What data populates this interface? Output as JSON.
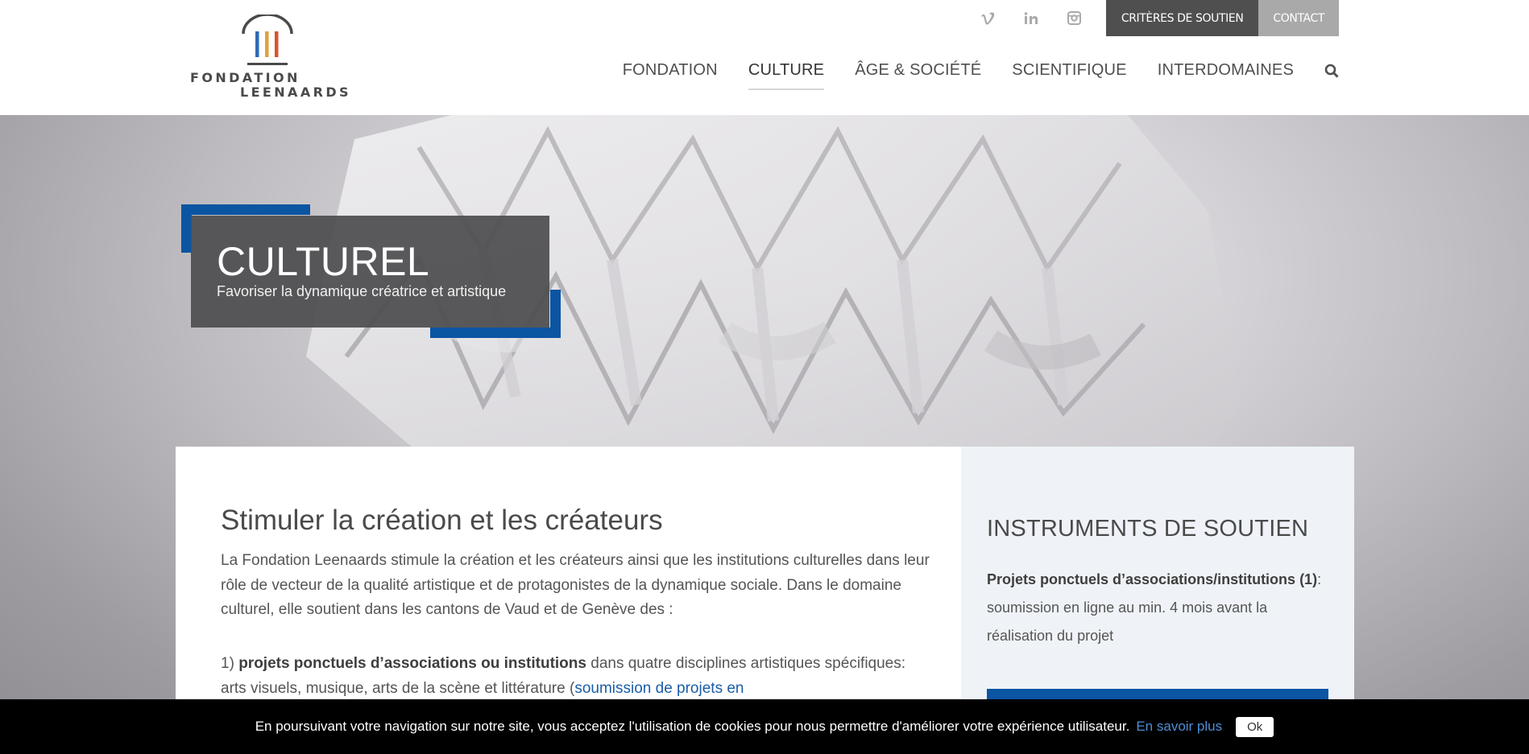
{
  "brand": {
    "line1": "FONDATION",
    "line2": "LEENAARDS",
    "stripe_colors": [
      "#2e6ab3",
      "#e0a23a",
      "#d9542c"
    ]
  },
  "social": [
    {
      "name": "vimeo-icon",
      "glyph": "v"
    },
    {
      "name": "linkedin-icon",
      "glyph": "in"
    },
    {
      "name": "instagram-icon",
      "glyph": "instagram"
    }
  ],
  "topbar": {
    "criteres": "CRITÈRES DE SOUTIEN",
    "contact": "CONTACT"
  },
  "nav": {
    "items": [
      {
        "label": "FONDATION"
      },
      {
        "label": "CULTURE"
      },
      {
        "label": "ÂGE & SOCIÉTÉ"
      },
      {
        "label": "SCIENTIFIQUE"
      },
      {
        "label": "INTERDOMAINES"
      }
    ],
    "active": "CULTURE",
    "search_icon": "search-icon"
  },
  "hero": {
    "title": "CULTUREL",
    "subtitle": "Favoriser la dynamique créatrice et artistique",
    "accent_color": "#0b55a2"
  },
  "main": {
    "heading": "Stimuler la création et les créateurs",
    "intro": "La Fondation Leenaards stimule la création et les créateurs ainsi que les institutions culturelles dans leur rôle de vecteur de la qualité artistique et de protagonistes de la dynamique sociale. Dans le domaine culturel, elle soutient dans les cantons de Vaud et de Genève des :",
    "item1_prefix": "1) ",
    "item1_bold": "projets ponctuels d’associations ou institutions",
    "item1_text": " dans quatre disciplines artistiques spécifiques: arts visuels, musique, arts de la scène et littérature (",
    "item1_link": "soumission de projets en"
  },
  "sidebar": {
    "heading": "INSTRUMENTS DE SOUTIEN",
    "projets_bold": "Projets ponctuels d’associations/institutions (1)",
    "projets_text": ": soumission en ligne au min. 4 mois avant la réalisation du projet"
  },
  "cookie": {
    "text": "En poursuivant votre navigation sur notre site, vous acceptez l'utilisation de cookies pour nous permettre d'améliorer votre expérience utilisateur.",
    "link": "En savoir plus",
    "ok": "Ok"
  }
}
